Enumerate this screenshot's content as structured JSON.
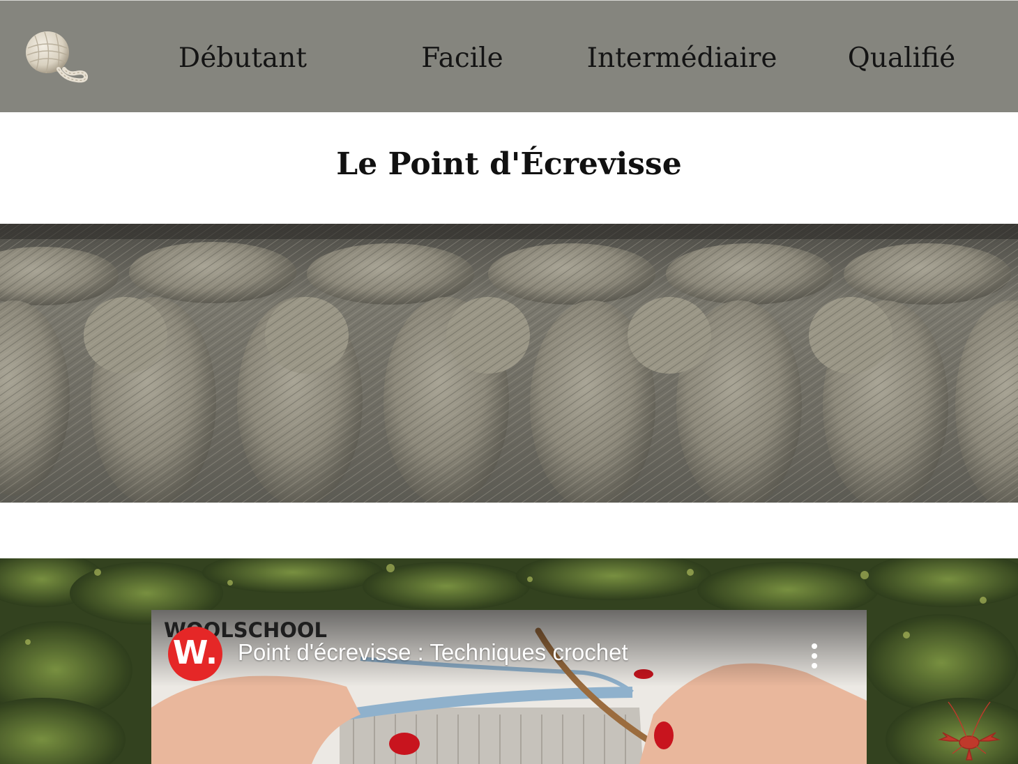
{
  "header": {
    "logo_icon": "yarn-ball-icon",
    "nav": [
      {
        "label": "Débutant"
      },
      {
        "label": "Facile"
      },
      {
        "label": "Intermédiaire"
      },
      {
        "label": "Qualifié"
      }
    ],
    "background": "#85857e"
  },
  "page": {
    "title": "Le Point d'Écrevisse"
  },
  "video": {
    "channel_logo": "WOOLSCHOOL",
    "channel_avatar_letter": "W.",
    "title": "Point d'écrevisse : Techniques crochet",
    "menu_icon": "more-vertical-icon",
    "avatar_color": "#e52727"
  },
  "colors": {
    "yarn": "#8d8a7d",
    "forest": "#3a4a26",
    "blue_yarn": "#8fb1cc"
  }
}
